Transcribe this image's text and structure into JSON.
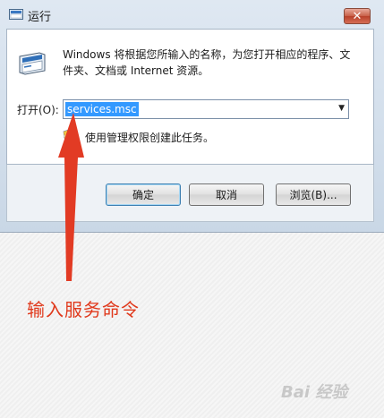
{
  "window": {
    "title": "运行",
    "close_label": "✕"
  },
  "dialog": {
    "description": "Windows 将根据您所输入的名称，为您打开相应的程序、文件夹、文档或 Internet 资源。",
    "open_label": "打开(O):",
    "open_value": "services.msc",
    "admin_note": "使用管理权限创建此任务。"
  },
  "buttons": {
    "ok": "确定",
    "cancel": "取消",
    "browse": "浏览(B)..."
  },
  "annotation": {
    "text": "输入服务命令",
    "color": "#e0391c"
  },
  "watermark": {
    "text": "Bai 经验"
  }
}
